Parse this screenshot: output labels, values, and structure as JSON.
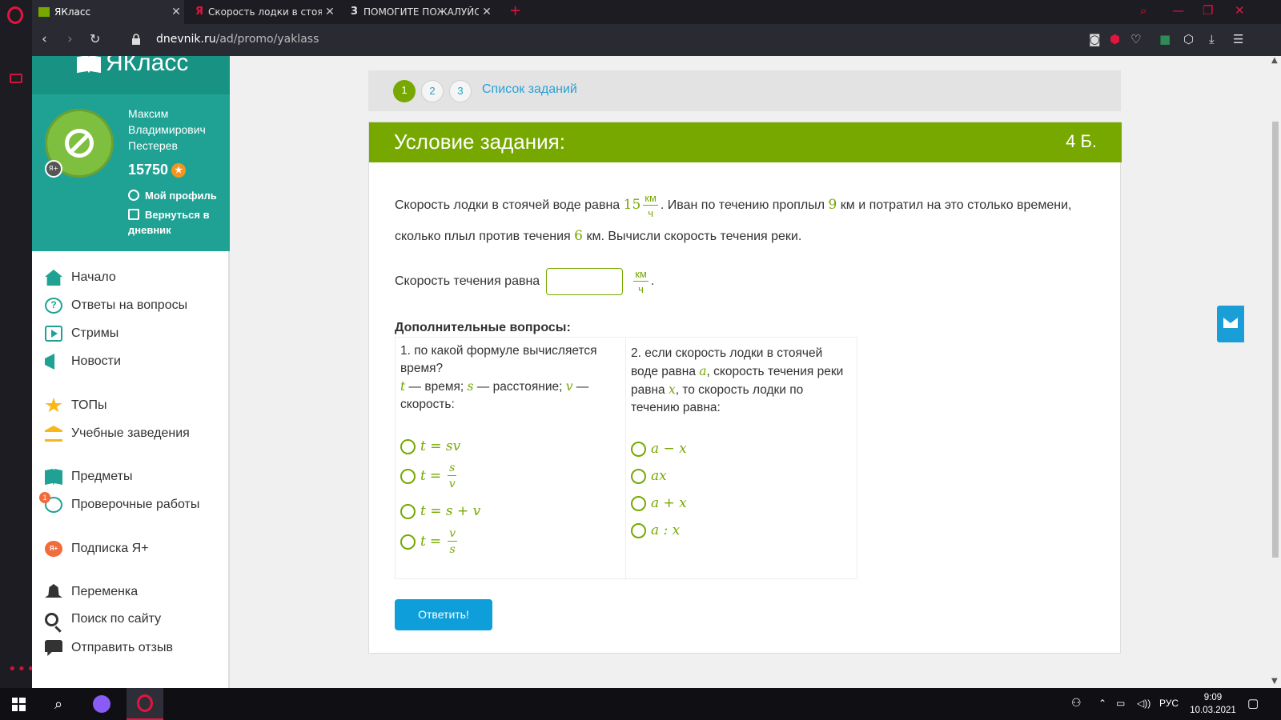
{
  "browser": {
    "tabs": [
      {
        "title": "ЯКласс",
        "favicon": "yaklass-icon"
      },
      {
        "title": "Скорость лодки в стоячей",
        "favicon": "yandex-icon"
      },
      {
        "title": "ПОМОГИТЕ ПОЖАЛУЙСТА",
        "favicon": "znanija-icon"
      }
    ],
    "url_domain": "dnevnik.ru",
    "url_path": "/ad/promo/yaklass"
  },
  "sidebar": {
    "logo": "ЯКласс",
    "user_name": "Максим Владимирович Пестерев",
    "points": "15750",
    "profile_link": "Мой профиль",
    "back_link": "Вернуться в дневник",
    "menu": [
      {
        "label": "Начало",
        "icon": "home-icon"
      },
      {
        "label": "Ответы на вопросы",
        "icon": "question-icon"
      },
      {
        "label": "Стримы",
        "icon": "play-icon"
      },
      {
        "label": "Новости",
        "icon": "megaphone-icon"
      },
      {
        "label": "ТОПы",
        "icon": "star-icon"
      },
      {
        "label": "Учебные заведения",
        "icon": "school-icon"
      },
      {
        "label": "Предметы",
        "icon": "books-icon"
      },
      {
        "label": "Проверочные работы",
        "icon": "check-icon",
        "badge": "1"
      },
      {
        "label": "Подписка Я+",
        "icon": "subscription-icon"
      },
      {
        "label": "Переменка",
        "icon": "bell-icon"
      },
      {
        "label": "Поиск по сайту",
        "icon": "search-icon"
      },
      {
        "label": "Отправить отзыв",
        "icon": "message-icon"
      }
    ]
  },
  "steps": {
    "items": [
      "1",
      "2",
      "3"
    ],
    "current": "1",
    "list_link": "Список заданий"
  },
  "task": {
    "header": "Условие задания:",
    "score": "4 Б.",
    "cond_part1": "Скорость лодки в стоячей воде равна",
    "v_boat": "15",
    "unit_num": "км",
    "unit_den": "ч",
    "cond_part2": ". Иван по течению проплыл",
    "dist_down": "9",
    "cond_part3": "км и потратил на это столько времени,",
    "cond_part4": "сколько плыл против течения",
    "dist_up": "6",
    "cond_part5": "км. Вычисли скорость течения реки.",
    "answer_label": "Скорость течения равна",
    "answer_value": "",
    "answer_suffix": "."
  },
  "extra": {
    "title": "Дополнительные вопросы:",
    "q1": {
      "text_line1": "1. по какой формуле вычисляется время?",
      "t": "t",
      "t_desc": " — время; ",
      "s": "s",
      "s_desc": " — расстояние; ",
      "v": "v",
      "v_desc": " — скорость:",
      "options": [
        "t = sv",
        "t = s/v",
        "t = s + v",
        "t = v/s"
      ]
    },
    "q2": {
      "text_a": "2. если скорость лодки в стоячей воде равна ",
      "a": "a",
      "text_b": ", скорость течения реки равна ",
      "x": "x",
      "text_c": ", то скорость лодки по течению равна:",
      "options": [
        "a − x",
        "ax",
        "a + x",
        "a : x"
      ]
    }
  },
  "submit_label": "Ответить!",
  "taskbar": {
    "time": "9:09",
    "date": "10.03.2021",
    "lang": "РУС"
  },
  "colors": {
    "accent_green": "#76a800",
    "teal": "#1fa294",
    "button_blue": "#0e9ed9"
  }
}
